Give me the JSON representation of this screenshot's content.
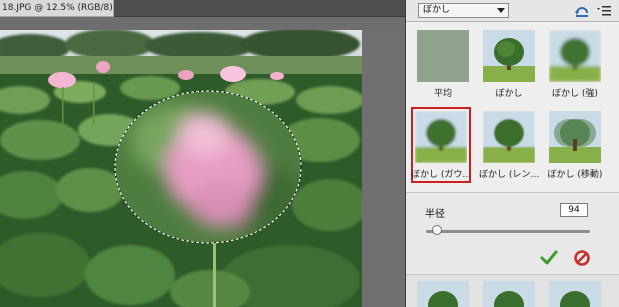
{
  "document": {
    "tab_title": "18.JPG @ 12.5% (RGB/8)",
    "tab_close": "×"
  },
  "panel": {
    "filter_dropdown": "ぼかし",
    "thumbnails": [
      {
        "label": "平均",
        "icon": "average-preview"
      },
      {
        "label": "ぼかし",
        "icon": "tree-sharp"
      },
      {
        "label": "ぼかし (強)",
        "icon": "tree-blur"
      },
      {
        "label": "ぼかし (ガウ…",
        "icon": "tree-gaussian",
        "selected": true
      },
      {
        "label": "ぼかし (レン…",
        "icon": "tree-lens"
      },
      {
        "label": "ぼかし (移動)",
        "icon": "tree-motion"
      }
    ],
    "radius": {
      "label": "半径",
      "value": "94",
      "slider_fraction": 0.07
    },
    "apply_icon": "checkmark-icon",
    "cancel_icon": "cancel-icon"
  },
  "colors": {
    "selection_border": "#cc1f1f",
    "apply_green": "#3f9a2a",
    "cancel_red": "#c62c2c"
  }
}
